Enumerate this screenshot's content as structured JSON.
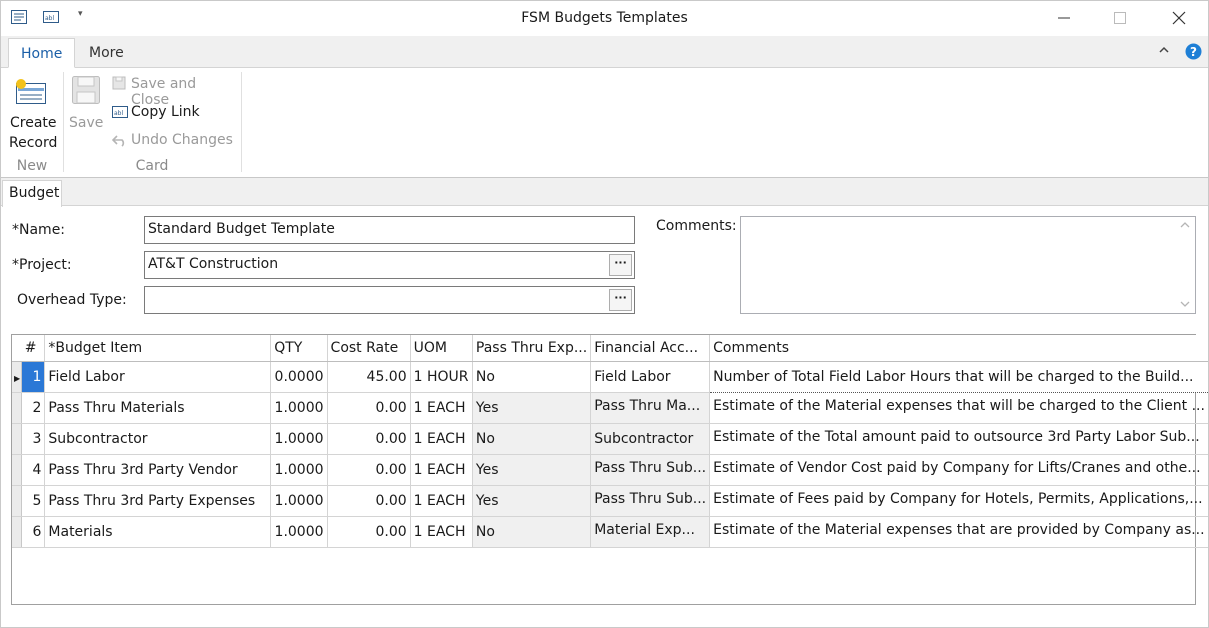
{
  "window": {
    "title": "FSM Budgets Templates"
  },
  "quick_access": {
    "icons": [
      "form-icon",
      "text-field-icon",
      "dropdown-arrow-icon"
    ]
  },
  "ribbon": {
    "tabs": [
      {
        "label": "Home",
        "active": true
      },
      {
        "label": "More",
        "active": false
      }
    ],
    "new_group": {
      "create_record_line1": "Create",
      "create_record_line2": "Record",
      "label": "New"
    },
    "card_group": {
      "save": "Save",
      "save_and_close": "Save and Close",
      "copy_link": "Copy Link",
      "undo_changes": "Undo Changes",
      "label": "Card"
    }
  },
  "section": {
    "tab_label": "Budget"
  },
  "form": {
    "name_label": "*Name:",
    "name_value": "Standard Budget Template",
    "project_label": "*Project:",
    "project_value": "AT&T Construction",
    "overhead_label": "Overhead Type:",
    "overhead_value": "",
    "comments_label": "Comments:",
    "comments_value": "",
    "ellipsis": "···"
  },
  "grid": {
    "columns": [
      "#",
      "*Budget Item",
      "QTY",
      "Cost Rate",
      "UOM",
      "Pass Thru Exp...",
      "Financial Acc...",
      "Comments"
    ],
    "rows": [
      {
        "n": "1",
        "item": "Field Labor",
        "qty": "0.0000",
        "rate": "45.00",
        "uom": "1 HOUR",
        "pass": "No",
        "fin": "Field Labor",
        "comments": "Number of Total Field Labor Hours that will be charged to the Build..."
      },
      {
        "n": "2",
        "item": "Pass Thru Materials",
        "qty": "1.0000",
        "rate": "0.00",
        "uom": "1 EACH",
        "pass": "Yes",
        "fin": "Pass Thru Ma...",
        "comments": "Estimate of the Material expenses that will be charged to the Client ..."
      },
      {
        "n": "3",
        "item": "Subcontractor",
        "qty": "1.0000",
        "rate": "0.00",
        "uom": "1 EACH",
        "pass": "No",
        "fin": "Subcontractor",
        "comments": "Estimate of the Total amount paid to outsource 3rd Party Labor Sub..."
      },
      {
        "n": "4",
        "item": "Pass Thru 3rd Party Vendor",
        "qty": "1.0000",
        "rate": "0.00",
        "uom": "1 EACH",
        "pass": "Yes",
        "fin": "Pass Thru Sub...",
        "comments": "Estimate of Vendor Cost paid by Company for Lifts/Cranes and othe..."
      },
      {
        "n": "5",
        "item": "Pass Thru 3rd Party Expenses",
        "qty": "1.0000",
        "rate": "0.00",
        "uom": "1 EACH",
        "pass": "Yes",
        "fin": "Pass Thru Sub...",
        "comments": "Estimate of Fees paid by Company for Hotels, Permits, Applications,..."
      },
      {
        "n": "6",
        "item": "Materials",
        "qty": "1.0000",
        "rate": "0.00",
        "uom": "1 EACH",
        "pass": "No",
        "fin": "Material Exp...",
        "comments": "Estimate of the Material expenses that are provided by Company as..."
      }
    ]
  },
  "colors": {
    "accent": "#1b5fa8",
    "help": "#1e7fd6"
  }
}
